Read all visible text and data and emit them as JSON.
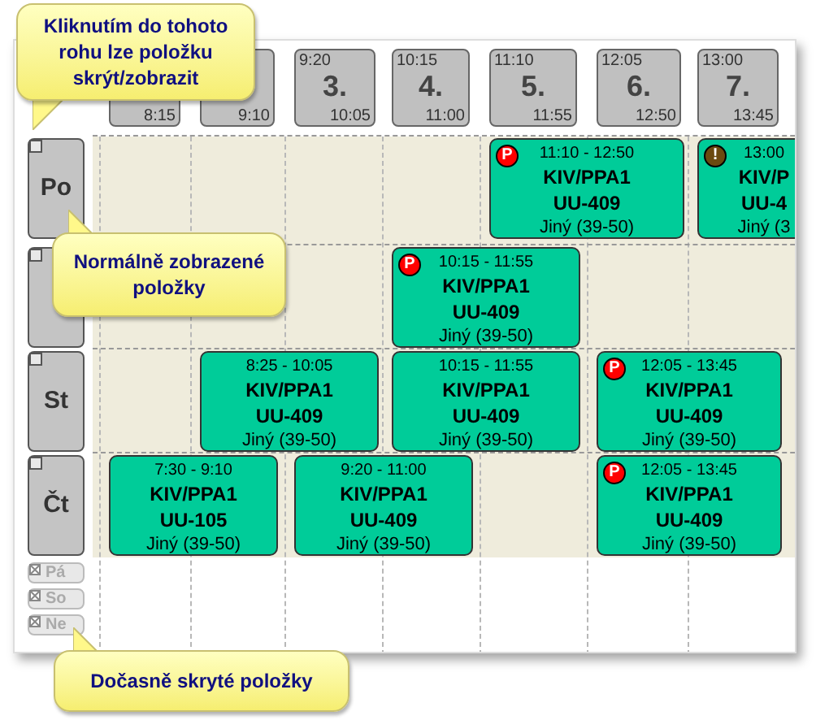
{
  "periods": [
    {
      "end": "8:15"
    },
    {
      "end": "9:10"
    },
    {
      "start": "9:20",
      "number": "3.",
      "end": "10:05"
    },
    {
      "start": "10:15",
      "number": "4.",
      "end": "11:00"
    },
    {
      "start": "11:10",
      "number": "5.",
      "end": "11:55"
    },
    {
      "start": "12:05",
      "number": "6.",
      "end": "12:50"
    },
    {
      "start": "13:00",
      "number": "7.",
      "end": "13:45"
    }
  ],
  "days": [
    {
      "label": "Po",
      "hidden": false,
      "events": [
        {
          "time": "11:10 - 12:50",
          "course": "KIV/PPA1",
          "room": "UU-409",
          "group": "Jiný (39-50)",
          "badge": {
            "kind": "p",
            "text": "P"
          }
        },
        {
          "time": "13:00",
          "course": "KIV/P",
          "room": "UU-4",
          "group": "Jiný (3",
          "badge": {
            "kind": "warning",
            "text": "!"
          }
        }
      ]
    },
    {
      "hidden": false,
      "events": [
        {
          "time": "10:15 - 11:55",
          "course": "KIV/PPA1",
          "room": "UU-409",
          "group": "Jiný (39-50)",
          "badge": {
            "kind": "p",
            "text": "P"
          }
        }
      ]
    },
    {
      "label": "St",
      "hidden": false,
      "events": [
        {
          "time": "8:25 - 10:05",
          "course": "KIV/PPA1",
          "room": "UU-409",
          "group": "Jiný (39-50)"
        },
        {
          "time": "10:15 - 11:55",
          "course": "KIV/PPA1",
          "room": "UU-409",
          "group": "Jiný (39-50)"
        },
        {
          "time": "12:05 - 13:45",
          "course": "KIV/PPA1",
          "room": "UU-409",
          "group": "Jiný (39-50)",
          "badge": {
            "kind": "p",
            "text": "P"
          }
        }
      ]
    },
    {
      "label": "Čt",
      "hidden": false,
      "events": [
        {
          "time": "7:30 - 9:10",
          "course": "KIV/PPA1",
          "room": "UU-105",
          "group": "Jiný (39-50)"
        },
        {
          "time": "9:20 - 11:00",
          "course": "KIV/PPA1",
          "room": "UU-409",
          "group": "Jiný (39-50)"
        },
        {
          "time": "12:05 - 13:45",
          "course": "KIV/PPA1",
          "room": "UU-409",
          "group": "Jiný (39-50)",
          "badge": {
            "kind": "p",
            "text": "P"
          }
        }
      ]
    },
    {
      "label": "Pá",
      "hidden": true
    },
    {
      "label": "So",
      "hidden": true
    },
    {
      "label": "Ne",
      "hidden": true
    }
  ],
  "callouts": [
    {
      "text": "Kliknutím do tohoto rohu lze položku skrýt/zobrazit"
    },
    {
      "text": "Normálně zobrazené položky"
    },
    {
      "text": "Dočasně skryté položky"
    }
  ]
}
